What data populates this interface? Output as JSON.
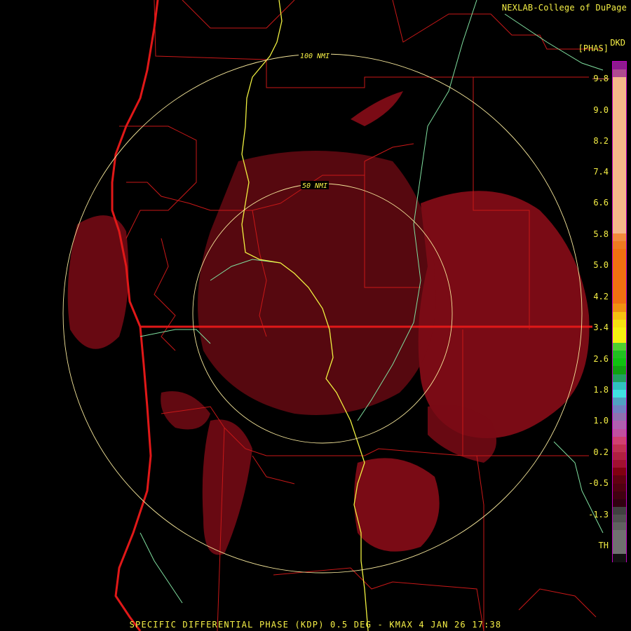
{
  "header": {
    "credit": "NEXLAB-College of DuPage",
    "product_code": "DKD",
    "units": "[PHAS]"
  },
  "rings": [
    {
      "label": "100 NMI"
    },
    {
      "label": "50 NMI"
    }
  ],
  "color_scale": {
    "labels": [
      "9.8",
      "9.0",
      "8.2",
      "7.4",
      "6.6",
      "5.8",
      "5.0",
      "4.2",
      "3.4",
      "2.6",
      "1.8",
      "1.0",
      "0.2",
      "-0.5",
      "-1.3",
      "TH"
    ],
    "colors": [
      "#8e1a8e",
      "#b04a90",
      "#f5b78a",
      "#f5b78a",
      "#f5b78a",
      "#f5b78a",
      "#f5b78a",
      "#f5b78a",
      "#f5b78a",
      "#f5b78a",
      "#f5b78a",
      "#f5b78a",
      "#f5b78a",
      "#f5b78a",
      "#f5b78a",
      "#f5b78a",
      "#f5b78a",
      "#f5b78a",
      "#f5b78a",
      "#f5b78a",
      "#f5b78a",
      "#f5b78a",
      "#f28a3c",
      "#f07a20",
      "#f07010",
      "#f07010",
      "#f07010",
      "#f07010",
      "#f07010",
      "#f07010",
      "#f07010",
      "#f09010",
      "#f6c010",
      "#f6e010",
      "#f6f010",
      "#f6f010",
      "#50d030",
      "#20c020",
      "#10c010",
      "#10a010",
      "#20a060",
      "#30c0c0",
      "#40e0e0",
      "#50a0c0",
      "#7080c0",
      "#9070b0",
      "#b060b0",
      "#c050a0",
      "#d04070",
      "#c03050",
      "#b02040",
      "#a01030",
      "#800010",
      "#600010",
      "#500010",
      "#400010",
      "#300010",
      "#404040",
      "#505050",
      "#606060",
      "#707070",
      "#707070",
      "#707070",
      "#101010"
    ]
  },
  "footer": {
    "caption": "SPECIFIC DIFFERENTIAL PHASE (KDP) 0.5 DEG - KMAX 4 JAN 26 17:38"
  },
  "colors": {
    "echo": "#7a0b15",
    "echo_dark": "#5a0810",
    "boundary": "#d01818",
    "river": "#f0f040",
    "highway": "#80e0a0",
    "ring": "#f5e69a",
    "text": "#f6f046"
  }
}
